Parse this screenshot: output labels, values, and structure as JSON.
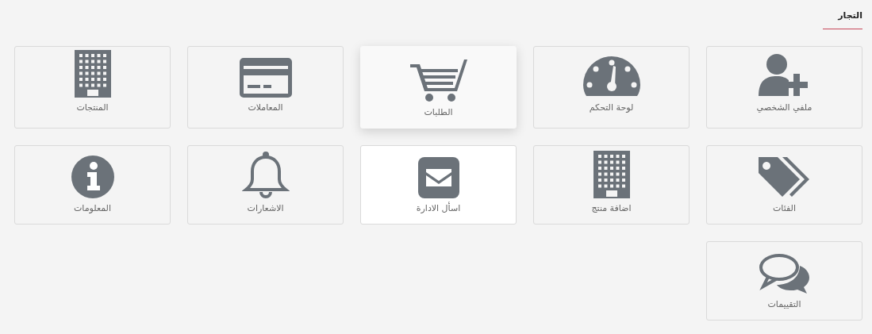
{
  "header": {
    "title": "التجار"
  },
  "tiles": [
    {
      "label": "ملفي الشخصي",
      "kind": "plain"
    },
    {
      "label": "لوحة التحكم",
      "kind": "plain"
    },
    {
      "label": "الطلبات",
      "kind": "raised"
    },
    {
      "label": "المعاملات",
      "kind": "plain"
    },
    {
      "label": "المنتجات",
      "kind": "plain"
    },
    {
      "label": "الفئات",
      "kind": "plain"
    },
    {
      "label": "اضافة منتج",
      "kind": "plain"
    },
    {
      "label": "اسأل الادارة",
      "kind": "white"
    },
    {
      "label": "الاشعارات",
      "kind": "plain"
    },
    {
      "label": "المعلومات",
      "kind": "plain"
    },
    {
      "label": "التقييمات",
      "kind": "plain"
    }
  ]
}
